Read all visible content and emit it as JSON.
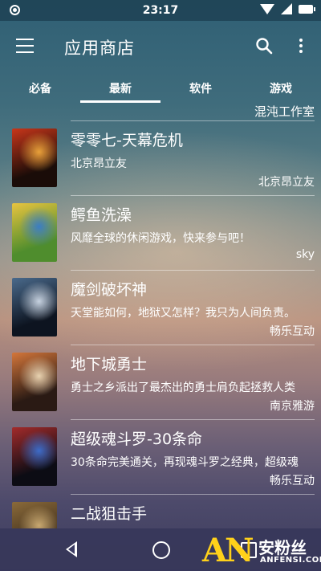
{
  "status": {
    "time": "23:17"
  },
  "appbar": {
    "title": "应用商店",
    "icons": [
      "menu-icon",
      "search-icon",
      "more-vert-icon"
    ]
  },
  "tabs": [
    {
      "label": "必备",
      "active": false
    },
    {
      "label": "最新",
      "active": true
    },
    {
      "label": "软件",
      "active": false
    },
    {
      "label": "游戏",
      "active": false
    }
  ],
  "list": {
    "partial_top_developer": "混沌工作室",
    "items": [
      {
        "name": "零零七-天幕危机",
        "desc": "北京昂立友",
        "developer": "北京昂立友",
        "thumb_colors": [
          "#1a0c08",
          "#c8361a",
          "#e9a13a"
        ]
      },
      {
        "name": "鳄鱼洗澡",
        "desc": "风靡全球的休闲游戏，快来参与吧！",
        "developer": "sky",
        "thumb_colors": [
          "#4f8d2d",
          "#e9c43f",
          "#3b7dc4"
        ]
      },
      {
        "name": "魔剑破坏神",
        "desc": "天堂能如何，地狱又怎样？我只为人间负责。",
        "developer": "畅乐互动",
        "thumb_colors": [
          "#0d1420",
          "#4a6a8c",
          "#c7d2e0"
        ]
      },
      {
        "name": "地下城勇士",
        "desc": "勇士之乡派出了最杰出的勇士肩负起拯救人类",
        "developer": "南京雅游",
        "thumb_colors": [
          "#2a1a14",
          "#d4763a",
          "#e8d2b0"
        ]
      },
      {
        "name": "超级魂斗罗-30条命",
        "desc": "30条命完美通关，再现魂斗罗之经典，超级魂",
        "developer": "畅乐互动",
        "thumb_colors": [
          "#0c0c14",
          "#a32b2b",
          "#3d6cc9"
        ]
      },
      {
        "name": "二战狙击手",
        "desc": "",
        "developer": "",
        "thumb_colors": [
          "#3a2a1a",
          "#8a6a3a",
          "#c8a870"
        ]
      }
    ]
  },
  "watermark": {
    "an": "AN",
    "cn": "安粉丝",
    "en": "ANFENSI.COM"
  }
}
